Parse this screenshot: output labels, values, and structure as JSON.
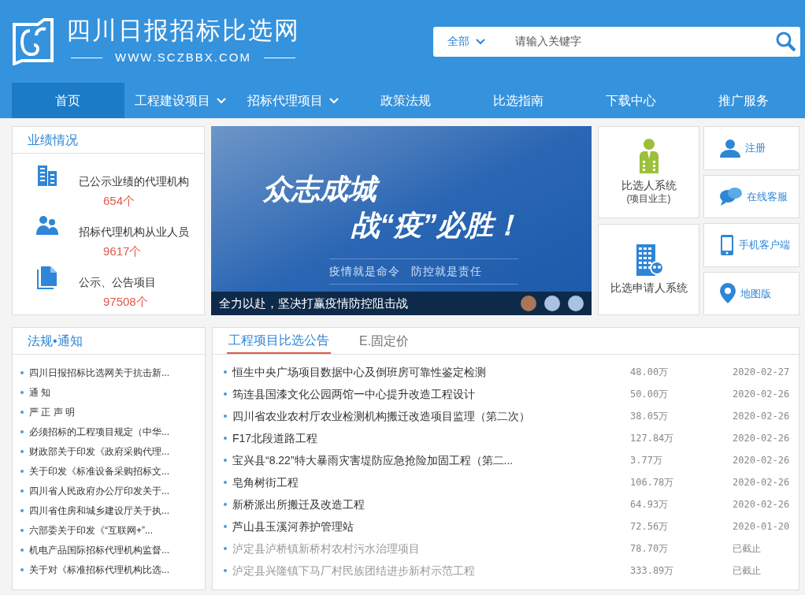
{
  "site": {
    "title": "四川日报招标比选网",
    "url": "WWW.SCZBBX.COM"
  },
  "search": {
    "scope": "全部",
    "placeholder": "请输入关键字"
  },
  "nav": [
    {
      "label": "首页",
      "selected": true,
      "dropdown": false
    },
    {
      "label": "工程建设项目",
      "selected": false,
      "dropdown": true
    },
    {
      "label": "招标代理项目",
      "selected": false,
      "dropdown": true
    },
    {
      "label": "政策法规",
      "selected": false,
      "dropdown": false
    },
    {
      "label": "比选指南",
      "selected": false,
      "dropdown": false
    },
    {
      "label": "下载中心",
      "selected": false,
      "dropdown": false
    },
    {
      "label": "推广服务",
      "selected": false,
      "dropdown": false
    }
  ],
  "stats": {
    "title": "业绩情况",
    "items": [
      {
        "kind": "buildings",
        "label": "已公示业绩的代理机构",
        "value": "654个"
      },
      {
        "kind": "people",
        "label": "招标代理机构从业人员",
        "value": "9617个"
      },
      {
        "kind": "document",
        "label": "公示、公告项目",
        "value": "97508个"
      }
    ]
  },
  "banner": {
    "headline_1": "众志成城",
    "headline_2": "战“疫”必胜！",
    "slogan_1": "疫情就是命令",
    "slogan_2": "防控就是责任",
    "caption": "全力以赴，坚决打赢疫情防控阻击战",
    "dots": [
      {
        "selected": true
      },
      {
        "selected": false
      },
      {
        "selected": false
      }
    ]
  },
  "systems": [
    {
      "kind": "owner",
      "label": "比选人系统",
      "sublabel": "(项目业主)"
    },
    {
      "kind": "applicant",
      "label": "比选申请人系统"
    }
  ],
  "services": [
    {
      "kind": "user",
      "label": "注册"
    },
    {
      "kind": "chat",
      "label": "在线客服"
    },
    {
      "kind": "phone",
      "label": "手机客户端"
    },
    {
      "kind": "pin",
      "label": "地图版"
    }
  ],
  "notices": {
    "title": "法规•通知",
    "items": [
      "四川日报招标比选网关于抗击新...",
      "通 知",
      "严 正 声 明",
      "必须招标的工程项目规定（中华...",
      "财政部关于印发《政府采购代理...",
      "关于印发《标准设备采购招标文...",
      "四川省人民政府办公厅印发关于...",
      "四川省住房和城乡建设厅关于执...",
      "六部委关于印发《“互联网+”...",
      "机电产品国际招标代理机构监督...",
      "关于对《标准招标代理机构比选..."
    ]
  },
  "announcements": {
    "tabs": [
      {
        "label": "工程项目比选公告",
        "selected": true
      },
      {
        "label": "E.固定价",
        "selected": false
      }
    ],
    "rows": [
      {
        "title": "恒生中央广场项目数据中心及倒班房可靠性鉴定检测",
        "amount": "48.00万",
        "date": "2020-02-27",
        "expired": false
      },
      {
        "title": "筠连县国漆文化公园两馆一中心提升改造工程设计",
        "amount": "50.00万",
        "date": "2020-02-26",
        "expired": false
      },
      {
        "title": "四川省农业农村厅农业检测机构搬迁改造项目监理（第二次）",
        "amount": "38.05万",
        "date": "2020-02-26",
        "expired": false
      },
      {
        "title": "F17北段道路工程",
        "amount": "127.84万",
        "date": "2020-02-26",
        "expired": false
      },
      {
        "title": "宝兴县“8.22”特大暴雨灾害堤防应急抢险加固工程（第二...",
        "amount": "3.77万",
        "date": "2020-02-26",
        "expired": false
      },
      {
        "title": "皂角树街工程",
        "amount": "106.78万",
        "date": "2020-02-26",
        "expired": false
      },
      {
        "title": "新桥派出所搬迁及改造工程",
        "amount": "64.93万",
        "date": "2020-02-26",
        "expired": false
      },
      {
        "title": "芦山县玉溪河养护管理站",
        "amount": "72.56万",
        "date": "2020-01-20",
        "expired": false
      },
      {
        "title": "泸定县泸桥镇新桥村农村污水治理项目",
        "amount": "78.70万",
        "date": "已截止",
        "expired": true
      },
      {
        "title": "泸定县兴隆镇下马厂村民族团结进步新村示范工程",
        "amount": "333.89万",
        "date": "已截止",
        "expired": true
      }
    ]
  }
}
